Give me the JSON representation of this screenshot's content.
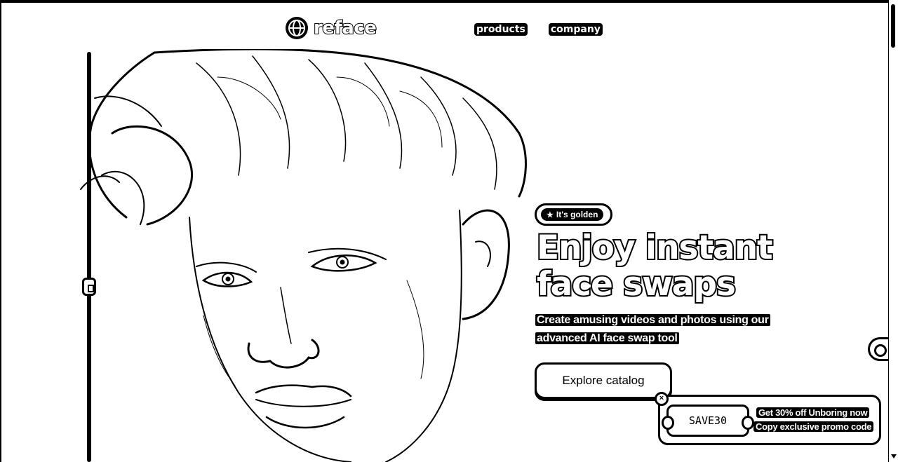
{
  "header": {
    "logo_text": "reface",
    "nav": [
      {
        "label": "products"
      },
      {
        "label": "company"
      }
    ]
  },
  "hero": {
    "badge": {
      "icon": "star-icon",
      "label": "It's golden"
    },
    "headline": "Enjoy instant face swaps",
    "subtext_line1": "Create amusing videos and photos using our",
    "subtext_line2": "advanced AI face swap tool",
    "cta_label": "Explore catalog"
  },
  "promo": {
    "close_symbol": "×",
    "code": "SAVE30",
    "title": "Get 30% off Unboring now",
    "subtitle": "Copy exclusive promo code"
  },
  "colors": {
    "background": "#ffffff",
    "ink": "#000000"
  }
}
